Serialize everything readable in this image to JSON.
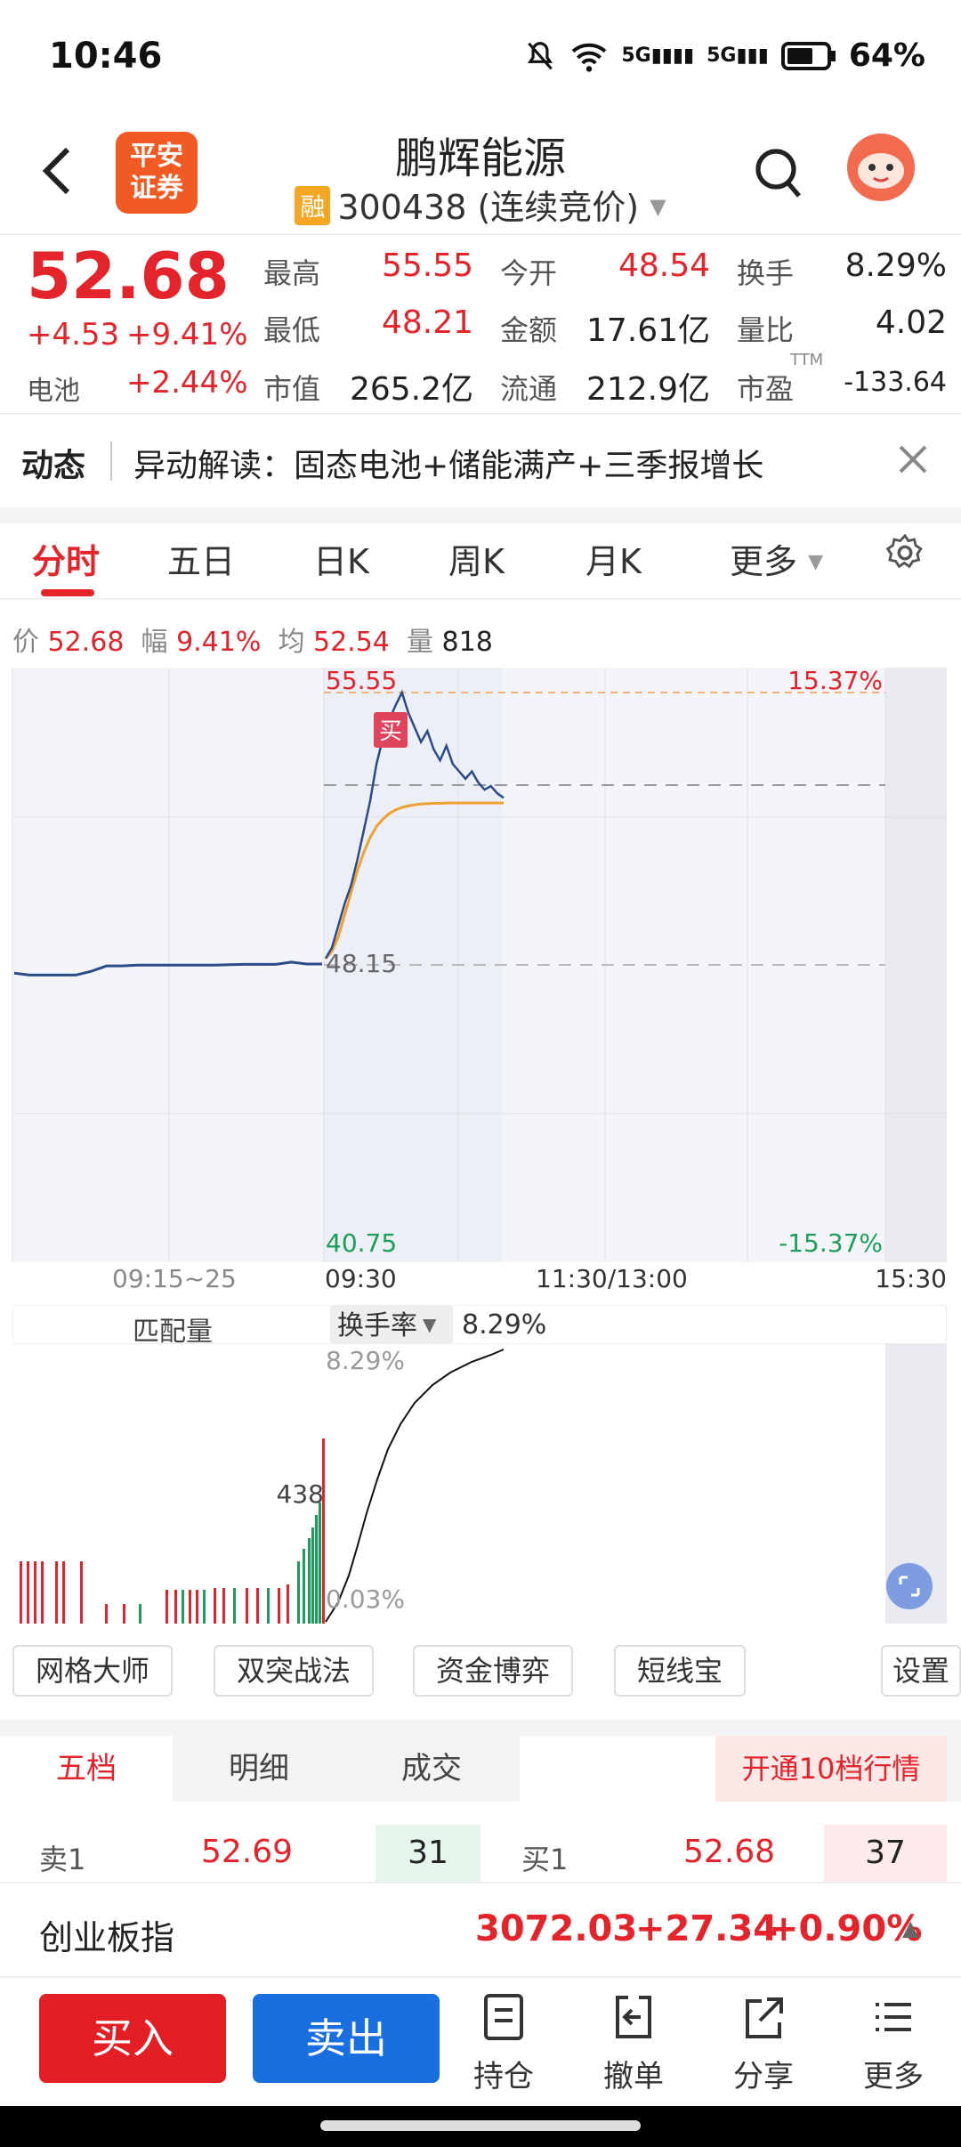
{
  "status": {
    "time": "10:46",
    "battery": "64%",
    "net1": "5G",
    "net2": "5G"
  },
  "header": {
    "broker_logo_line1": "平安",
    "broker_logo_line2": "证券",
    "stock_name": "鹏辉能源",
    "margin_badge": "融",
    "stock_code_status": "300438 (连续竞价)"
  },
  "quote": {
    "price": "52.68",
    "change": "+4.53",
    "change_pct": "+9.41%",
    "sector_label": "电池",
    "sector_pct": "+2.44%",
    "high_label": "最高",
    "high": "55.55",
    "open_label": "今开",
    "open": "48.54",
    "turnover_label": "换手",
    "turnover": "8.29%",
    "low_label": "最低",
    "low": "48.21",
    "amount_label": "金额",
    "amount": "17.61亿",
    "vol_ratio_label": "量比",
    "vol_ratio": "4.02",
    "mktcap_label": "市值",
    "mktcap": "265.2亿",
    "float_label": "流通",
    "float": "212.9亿",
    "pe_label": "市盈",
    "pe_sup": "TTM",
    "pe": "-133.64"
  },
  "news": {
    "tag": "动态",
    "text": "异动解读：固态电池+储能满产+三季报增长"
  },
  "tabs": [
    "分时",
    "五日",
    "日K",
    "周K",
    "月K",
    "更多"
  ],
  "chart_info": {
    "price_label": "价",
    "price": "52.68",
    "pct_label": "幅",
    "pct": "9.41%",
    "avg_label": "均",
    "avg": "52.54",
    "vol_label": "量",
    "vol": "818"
  },
  "chart_data": {
    "type": "line",
    "title": "",
    "y_top_label": "55.55",
    "y_mid_label": "48.15",
    "y_bottom_label": "40.75",
    "pct_top_label": "15.37%",
    "pct_bottom_label": "-15.37%",
    "buy_marker": "买",
    "x_labels": [
      "09:15~25",
      "09:30",
      "11:30/13:00",
      "15:30"
    ],
    "ylim": [
      40.75,
      55.55
    ],
    "preauction_price": [
      47.9,
      47.85,
      47.85,
      47.85,
      47.85,
      47.95,
      48.1,
      48.1,
      48.12,
      48.12,
      48.12,
      48.12,
      48.12,
      48.12,
      48.13,
      48.14,
      48.14,
      48.14,
      48.2,
      48.15,
      48.15
    ],
    "price": [
      48.3,
      48.6,
      49.2,
      49.8,
      50.3,
      51.0,
      51.8,
      52.6,
      53.6,
      54.3,
      54.8,
      55.2,
      55.55,
      55.0,
      54.6,
      54.2,
      54.5,
      54.0,
      53.7,
      54.1,
      53.6,
      53.4,
      53.2,
      53.4,
      53.1,
      52.9,
      53.0,
      52.8,
      52.68
    ],
    "average": [
      48.3,
      48.5,
      48.9,
      49.5,
      50.1,
      50.7,
      51.2,
      51.6,
      51.9,
      52.1,
      52.25,
      52.35,
      52.42,
      52.46,
      52.49,
      52.51,
      52.52,
      52.53,
      52.53,
      52.54,
      52.54,
      52.54,
      52.54,
      52.54,
      52.54,
      52.54,
      52.54,
      52.54,
      52.54
    ]
  },
  "sub_chart": {
    "left_title": "匹配量",
    "selector": "换手率",
    "value": "8.29%",
    "top_label": "8.29%",
    "bottom_label": "0.03%",
    "auction_label": "438"
  },
  "strategy_buttons": [
    "网格大师",
    "双突战法",
    "资金博弈",
    "短线宝",
    "设置"
  ],
  "orderbook": {
    "tabs": [
      "五档",
      "明细",
      "成交"
    ],
    "upgrade": "开通10档行情",
    "sell1_label": "卖1",
    "sell1_price": "52.69",
    "sell1_vol": "31",
    "buy1_label": "买1",
    "buy1_price": "52.68",
    "buy1_vol": "37"
  },
  "index_bar": {
    "name": "创业板指",
    "value": "3072.03",
    "change": "+27.34",
    "pct": "+0.90%"
  },
  "actions": {
    "buy": "买入",
    "sell": "卖出",
    "position": "持仓",
    "cancel": "撤单",
    "share": "分享",
    "more": "更多"
  },
  "colors": {
    "up": "#e5232b",
    "down": "#1a9e5a",
    "price_line": "#2a4a8a",
    "avg_line": "#f0a030",
    "buy_btn": "#e41e25",
    "sell_btn": "#1a6fe0"
  }
}
